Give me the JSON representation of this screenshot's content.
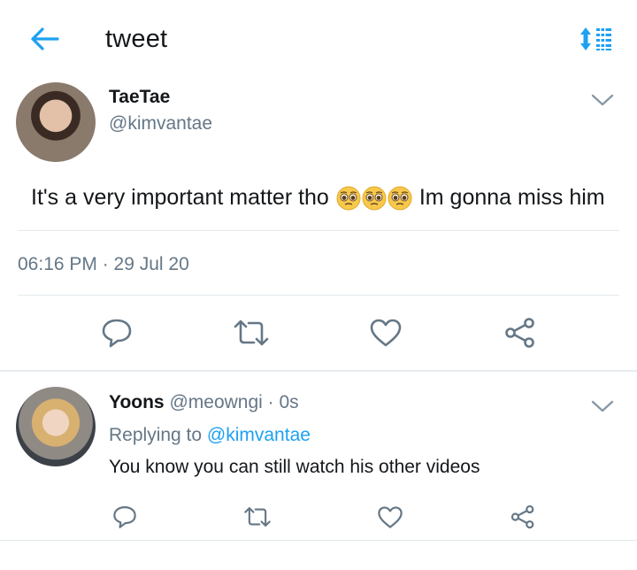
{
  "topbar": {
    "title": "tweet",
    "back_icon": "arrow-left-icon",
    "sort_icon": "sort-timeline-icon",
    "accent_color": "#1da1f2"
  },
  "tweet": {
    "display_name": "TaeTae",
    "handle": "@kimvantae",
    "text_before": "It's a very important matter tho",
    "emojis": [
      "pleading-face",
      "pleading-face",
      "pleading-face"
    ],
    "text_after": "Im gonna miss him",
    "timestamp": "06:16 PM · 29 Jul 20",
    "actions": [
      "reply-icon",
      "retweet-icon",
      "like-icon",
      "share-icon"
    ]
  },
  "reply": {
    "display_name": "Yoons",
    "handle_meta": "@meowngi · 0s",
    "replying_prefix": "Replying to",
    "replying_to": "@kimvantae",
    "text": "You know you can still watch his other videos",
    "actions": [
      "reply-icon",
      "retweet-icon",
      "like-icon",
      "share-icon"
    ]
  },
  "colors": {
    "text": "#14171a",
    "secondary": "#657786",
    "divider": "#e1e8ed",
    "link": "#1da1f2"
  }
}
